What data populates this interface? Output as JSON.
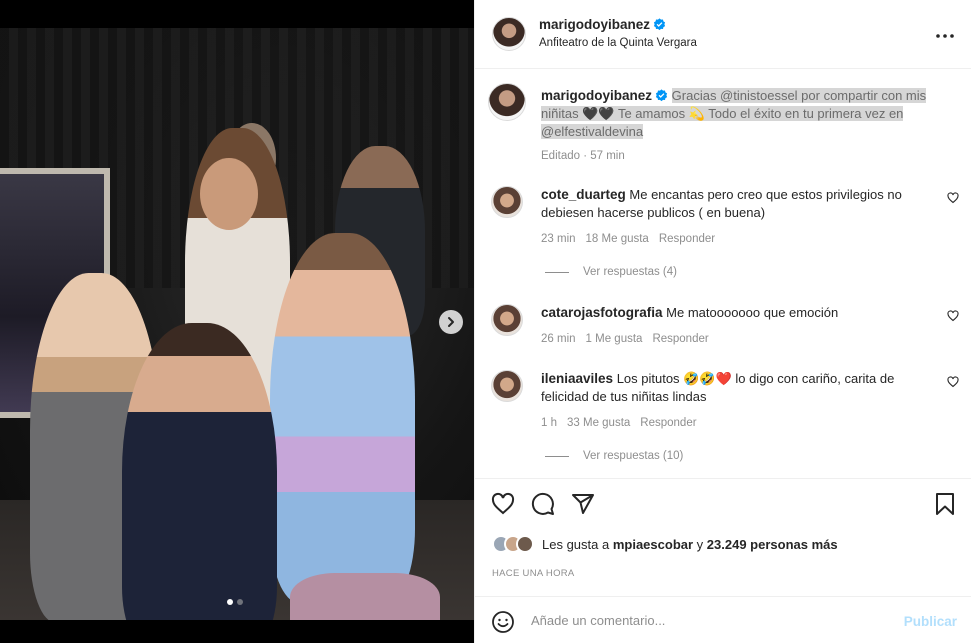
{
  "post": {
    "username": "marigodoyibanez",
    "location": "Anfiteatro de la Quinta Vergara"
  },
  "caption": {
    "username": "marigodoyibanez",
    "text": "Gracias @tinistoessel por compartir con mis niñitas 🖤🖤 Te amamos 💫 Todo el éxito en tu primera vez en @elfestivaldevina",
    "meta": "Editado · 57 min"
  },
  "comments": [
    {
      "username": "cote_duarteg",
      "text": "Me encantas pero creo que estos privilegios no debiesen hacerse publicos ( en buena)",
      "time": "23 min",
      "likes": "18 Me gusta",
      "reply": "Responder",
      "view_replies": "Ver respuestas (4)"
    },
    {
      "username": "catarojasfotografia",
      "text": "Me matooooooo que emoción",
      "time": "26 min",
      "likes": "1 Me gusta",
      "reply": "Responder"
    },
    {
      "username": "ileniaaviles",
      "text": "Los pitutos 🤣🤣❤️ lo digo con cariño, carita de felicidad de tus niñitas lindas",
      "time": "1 h",
      "likes": "33 Me gusta",
      "reply": "Responder",
      "view_replies": "Ver respuestas (10)"
    }
  ],
  "likes": {
    "prefix": "Les gusta a",
    "user": "mpiaescobar",
    "connector": "y",
    "others": "23.249 personas más"
  },
  "timestamp": "HACE UNA HORA",
  "composer": {
    "placeholder": "Añade un comentario...",
    "publish": "Publicar"
  },
  "carousel": {
    "current": 1,
    "total": 2
  },
  "colors": {
    "verified": "#0095f6",
    "publish_disabled": "#b2dffc",
    "muted": "#8e8e8e"
  },
  "icons": [
    "more-icon",
    "verified-icon",
    "heart-icon",
    "comment-icon",
    "share-icon",
    "bookmark-icon",
    "emoji-icon",
    "chevron-right-icon"
  ]
}
